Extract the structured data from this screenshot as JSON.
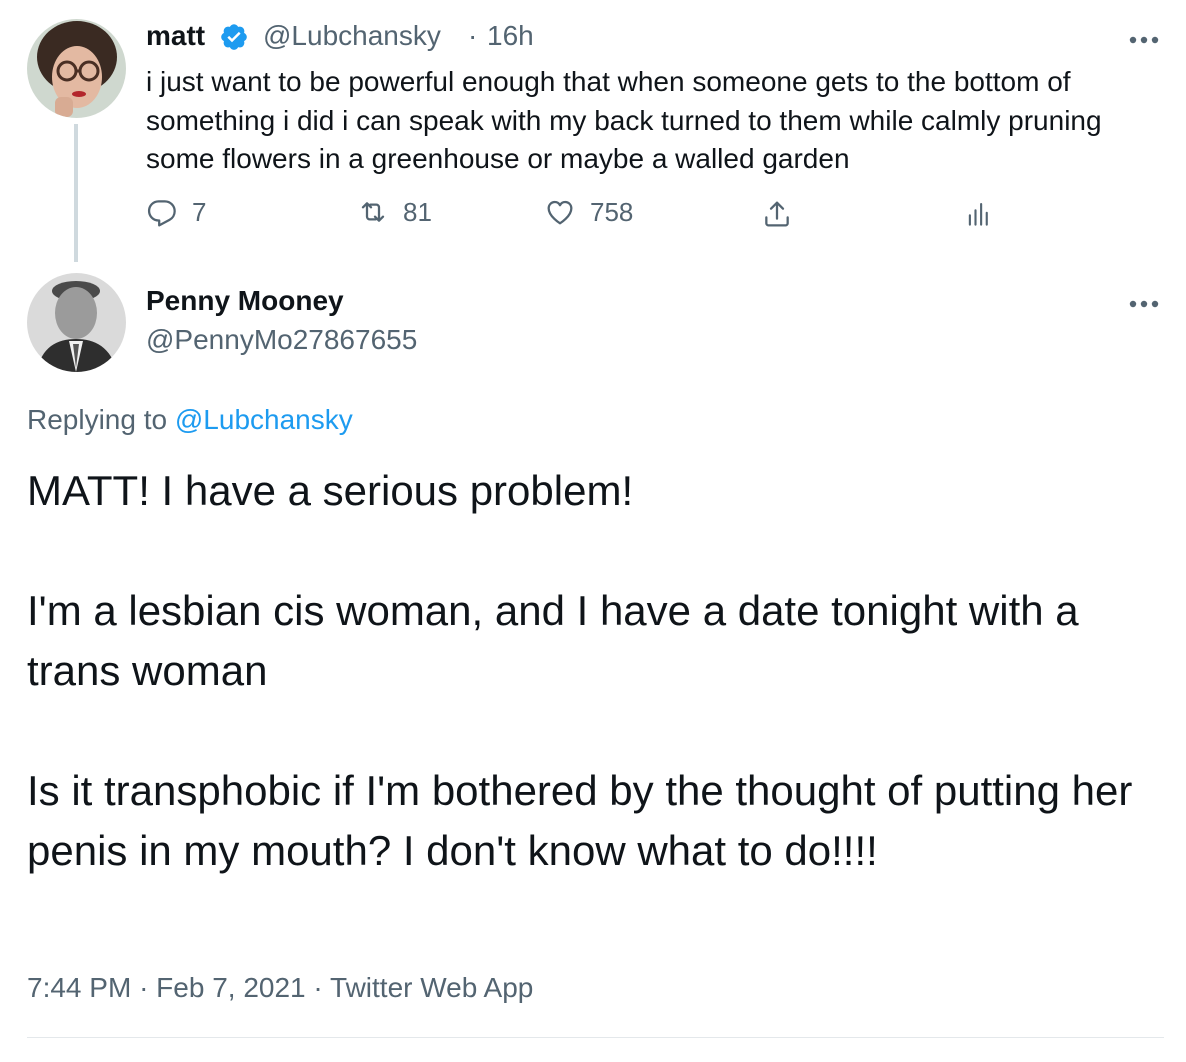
{
  "colors": {
    "text_primary": "#0f1419",
    "text_secondary": "#536471",
    "link_blue": "#1d9bf0",
    "verified_blue": "#1d9bf0",
    "thread_line": "#cfd9de"
  },
  "parent_tweet": {
    "author_name": "matt",
    "verified_icon": "verified-badge-icon",
    "handle": "@Lubchansky",
    "separator": "·",
    "time": "16h",
    "text": "i just want to be powerful enough that when someone gets to the bottom of something i did i can speak with my back turned to them while calmly pruning some flowers in a greenhouse or maybe a walled garden",
    "actions": {
      "reply_count": "7",
      "retweet_count": "81",
      "like_count": "758"
    },
    "more_icon": "more-horizontal-icon"
  },
  "reply_tweet": {
    "author_name": "Penny Mooney",
    "handle": "@PennyMo27867655",
    "more_icon": "more-horizontal-icon",
    "replying_prefix": "Replying to",
    "replying_mention": "@Lubchansky",
    "paragraphs": [
      "MATT! I have a serious problem!",
      "I'm a lesbian cis woman, and I have a date tonight with a trans woman",
      "Is it transphobic if I'm bothered by the thought of putting her penis in my mouth? I don't know what to do!!!!"
    ],
    "time": "7:44 PM",
    "separator": "·",
    "date": "Feb 7, 2021",
    "source": "Twitter Web App"
  }
}
